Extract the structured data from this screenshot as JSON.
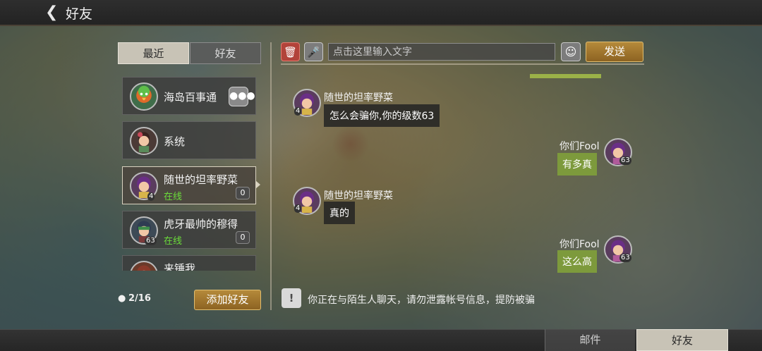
{
  "header": {
    "back_icon": "chevron-left-icon",
    "title": "好友"
  },
  "tabs": [
    {
      "label": "最近",
      "active": true
    },
    {
      "label": "好友",
      "active": false
    }
  ],
  "friends": [
    {
      "name": "海岛百事通",
      "status": "",
      "level": "",
      "unread": "",
      "has_chat_icon": true
    },
    {
      "name": "系统",
      "status": "",
      "level": "",
      "unread": ""
    },
    {
      "name": "随世的坦率野菜",
      "status": "在线",
      "level": "4",
      "unread": "0",
      "selected": true
    },
    {
      "name": "虎牙最帅的穆得",
      "status": "在线",
      "level": "63",
      "unread": "0"
    },
    {
      "name": "来锤我",
      "status": "",
      "level": "",
      "unread": ""
    }
  ],
  "friend_count": "2/16",
  "add_friend_label": "添加好友",
  "input": {
    "placeholder": "点击这里输入文字",
    "value": ""
  },
  "send_label": "发送",
  "messages": [
    {
      "sender": "随世的坦率野菜",
      "level": "4",
      "text": "怎么会骗你,你的级数63",
      "side": "left"
    },
    {
      "sender": "你们Fool",
      "level": "63",
      "text": "有多真",
      "side": "right"
    },
    {
      "sender": "随世的坦率野菜",
      "level": "4",
      "text": "真的",
      "side": "left"
    },
    {
      "sender": "你们Fool",
      "level": "63",
      "text": "这么高",
      "side": "right"
    }
  ],
  "notice": "你正在与陌生人聊天，请勿泄露帐号信息，提防被骗",
  "bottom_tabs": [
    {
      "label": "邮件",
      "active": false
    },
    {
      "label": "好友",
      "active": true
    }
  ],
  "colors": {
    "accent_gold": "#b58a3a",
    "online_green": "#6bdc3a",
    "out_bubble": "#7d9a3c",
    "delete_red": "#b2433a"
  }
}
